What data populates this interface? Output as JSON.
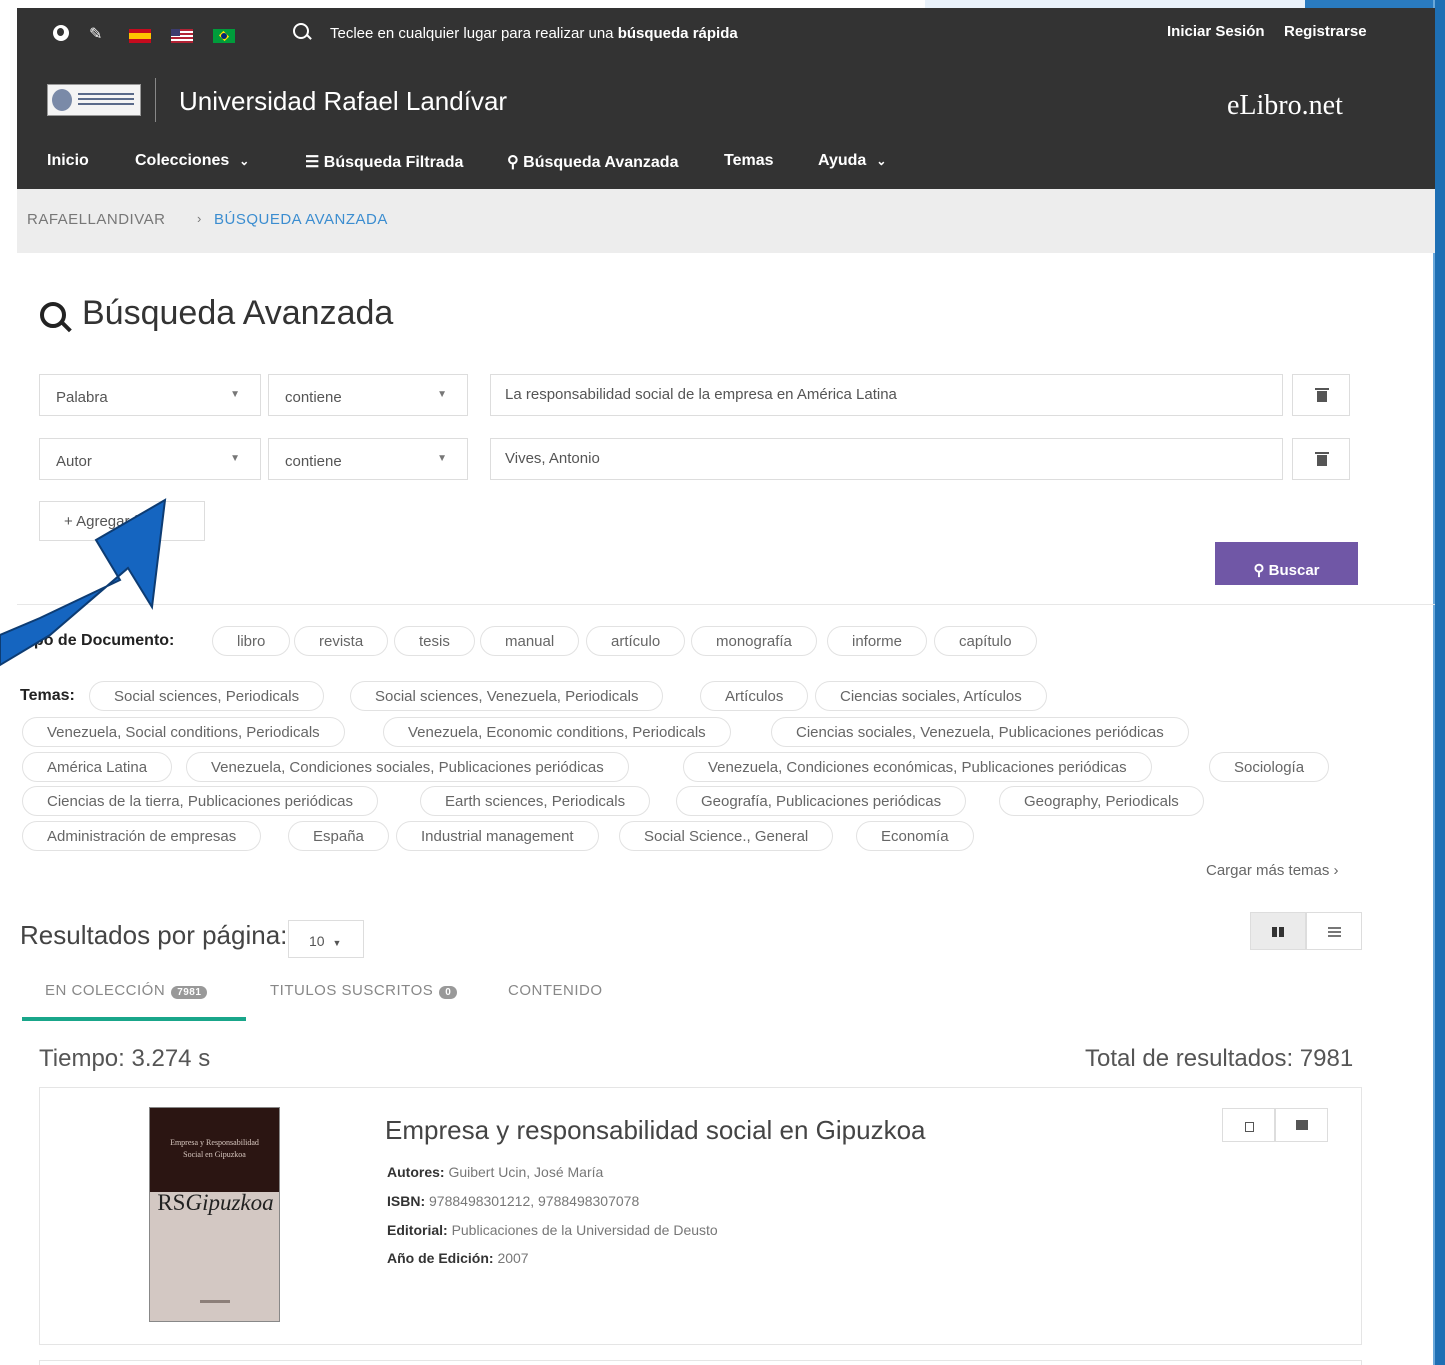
{
  "topbar": {
    "quick_search_prefix": "Teclee en cualquier lugar para realizar una ",
    "quick_search_bold": "búsqueda rápida",
    "login": "Iniciar Sesión",
    "register": "Registrarse"
  },
  "brand": {
    "university": "Universidad Rafael Landívar",
    "site": "eLibro.net"
  },
  "nav": {
    "inicio": "Inicio",
    "colecciones": "Colecciones",
    "filtrada": "Búsqueda Filtrada",
    "avanzada": "Búsqueda Avanzada",
    "temas": "Temas",
    "ayuda": "Ayuda"
  },
  "breadcrumb": {
    "root": "RAFAELLANDIVAR",
    "current": "BÚSQUEDA AVANZADA"
  },
  "page": {
    "title": "Búsqueda Avanzada"
  },
  "search": {
    "rows": [
      {
        "field": "Palabra",
        "operator": "contiene",
        "value": "La responsabilidad social de la empresa en América Latina"
      },
      {
        "field": "Autor",
        "operator": "contiene",
        "value": "Vives, Antonio"
      }
    ],
    "add_label": "+ Agregar filtro",
    "search_label": "Buscar"
  },
  "filters": {
    "doc_type_label": "Tipo de Documento:",
    "doc_types": [
      "libro",
      "revista",
      "tesis",
      "manual",
      "artículo",
      "monografía",
      "informe",
      "capítulo"
    ],
    "topics_label": "Temas:",
    "topics": [
      "Social sciences, Periodicals",
      "Social sciences, Venezuela, Periodicals",
      "Artículos",
      "Ciencias sociales, Artículos",
      "Venezuela, Social conditions, Periodicals",
      "Venezuela, Economic conditions, Periodicals",
      "Ciencias sociales, Venezuela, Publicaciones periódicas",
      "América Latina",
      "Venezuela, Condiciones sociales, Publicaciones periódicas",
      "Venezuela, Condiciones económicas, Publicaciones periódicas",
      "Sociología",
      "Ciencias de la tierra, Publicaciones periódicas",
      "Earth sciences, Periodicals",
      "Geografía, Publicaciones periódicas",
      "Geography, Periodicals",
      "Administración de empresas",
      "España",
      "Industrial management",
      "Social Science., General",
      "Economía"
    ],
    "load_more": "Cargar más temas ›"
  },
  "results": {
    "per_page_label": "Resultados por página:",
    "per_page_value": "10",
    "tabs": [
      {
        "label": "EN COLECCIÓN",
        "badge": "7981"
      },
      {
        "label": "TITULOS SUSCRITOS",
        "badge": "0"
      },
      {
        "label": "CONTENIDO",
        "badge": ""
      }
    ],
    "time": "Tiempo: 3.274 s",
    "total": "Total de resultados: 7981",
    "items": [
      {
        "title": "Empresa y responsabilidad social en Gipuzkoa",
        "autores_label": "Autores:",
        "autores": "Guibert Ucin, José María",
        "isbn_label": "ISBN:",
        "isbn": "9788498301212, 9788498307078",
        "editorial_label": "Editorial:",
        "editorial": "Publicaciones de la Universidad de Deusto",
        "anio_label": "Año de Edición:",
        "anio": "2007",
        "cover_title_a": "RS",
        "cover_title_b": "Gipuzkoa",
        "cover_line1": "Empresa y Responsabilidad",
        "cover_line2": "Social en Gipuzkoa"
      }
    ]
  },
  "colors": {
    "header_bg": "#333333",
    "search_button": "#7057a6",
    "tab_active": "#19a68a",
    "breadcrumb_link": "#3b8dd0",
    "arrow": "#1565c0"
  }
}
